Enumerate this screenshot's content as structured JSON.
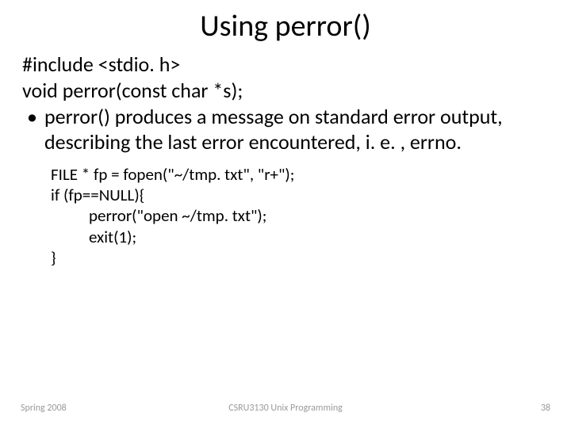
{
  "title": "Using perror()",
  "body": {
    "include": "#include <stdio. h>",
    "proto": " void perror(const char *s);",
    "bullet_marker": "•",
    "bullet": "perror() produces a message on standard error output, describing the last error encountered, i. e. , errno."
  },
  "code": {
    "l1": "FILE * fp = fopen(\"~/tmp. txt\", \"r+\");",
    "l2": "if (fp==NULL){",
    "l3": "perror(\"open ~/tmp. txt\");",
    "l4": "exit(1);",
    "l5": "}"
  },
  "footer": {
    "left": "Spring 2008",
    "center": "CSRU3130 Unix Programming",
    "right": "38"
  }
}
